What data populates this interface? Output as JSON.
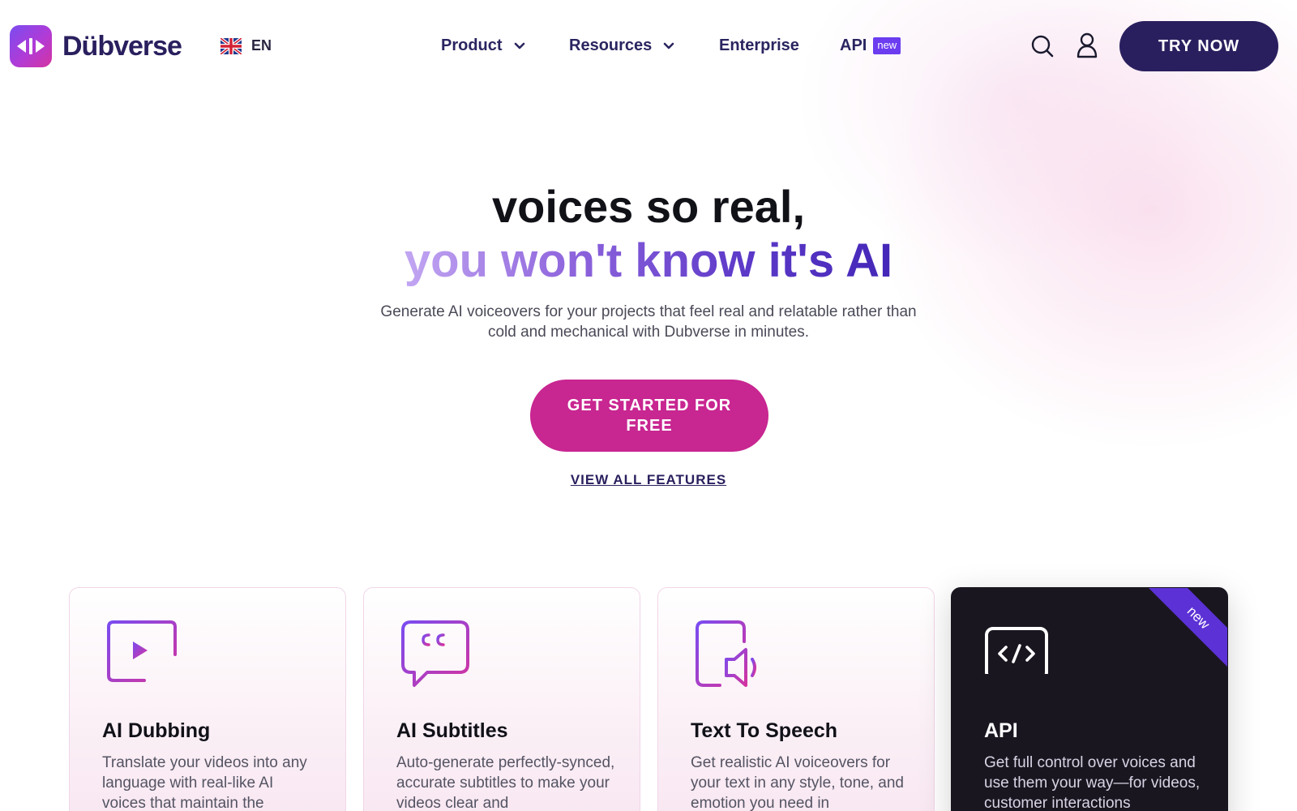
{
  "header": {
    "logo_text": "Dübverse",
    "language": "EN",
    "nav": [
      {
        "label": "Product",
        "has_dropdown": true
      },
      {
        "label": "Resources",
        "has_dropdown": true
      },
      {
        "label": "Enterprise",
        "has_dropdown": false
      },
      {
        "label": "API",
        "badge": "new"
      }
    ],
    "try_label": "TRY NOW"
  },
  "hero": {
    "title_line1": "voices so real,",
    "title_line2": "you won't know it's AI",
    "subtitle": "Generate AI voiceovers for your projects that feel real and relatable rather than cold and mechanical with Dubverse in minutes.",
    "cta_label": "GET STARTED FOR FREE",
    "features_link": "VIEW ALL FEATURES"
  },
  "cards": [
    {
      "title": "AI Dubbing",
      "desc": "Translate your videos into any language with real-like AI voices that maintain the",
      "icon": "video-voice-icon"
    },
    {
      "title": "AI Subtitles",
      "desc": "Auto-generate perfectly-synced, accurate subtitles to make your videos clear and",
      "icon": "subtitles-chat-icon"
    },
    {
      "title": "Text To Speech",
      "desc": "Get realistic AI voiceovers for your text in any style, tone, and emotion you need in",
      "icon": "document-speaker-icon"
    },
    {
      "title": "API",
      "desc": "Get full control over voices and use them your way—for videos, customer interactions",
      "icon": "code-icon",
      "ribbon": "new"
    }
  ],
  "colors": {
    "brand_dark": "#2a1f5e",
    "cta_magenta": "#c82691",
    "accent_purple": "#6c3cf0",
    "card_dark": "#1a1620"
  }
}
